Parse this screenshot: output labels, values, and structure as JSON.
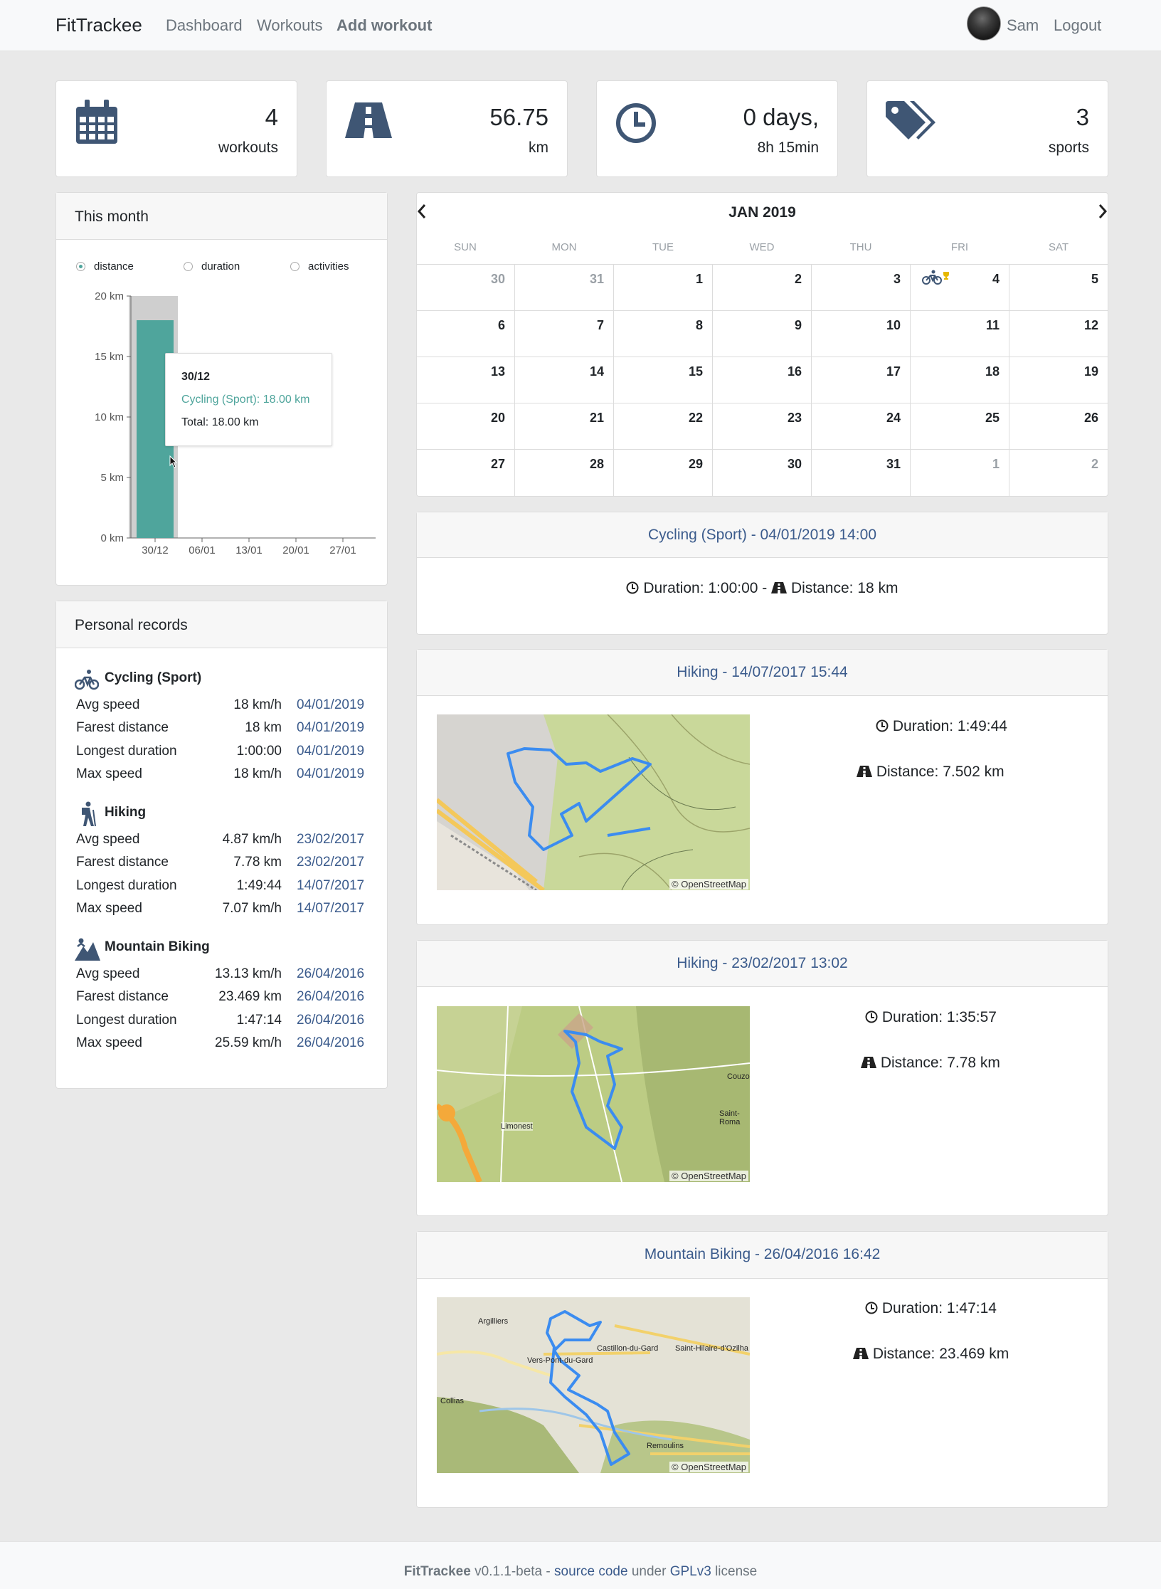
{
  "navbar": {
    "brand": "FitTrackee",
    "links": [
      "Dashboard",
      "Workouts",
      "Add workout"
    ],
    "user": "Sam",
    "logout": "Logout"
  },
  "stats": [
    {
      "icon": "calendar-icon",
      "value": "4",
      "label": "workouts"
    },
    {
      "icon": "road-icon",
      "value": "56.75",
      "label": "km"
    },
    {
      "icon": "clock-icon",
      "value": "0 days,",
      "label": "8h 15min"
    },
    {
      "icon": "tags-icon",
      "value": "3",
      "label": "sports"
    }
  ],
  "month": {
    "title": "This month",
    "options": [
      "distance",
      "duration",
      "activities"
    ],
    "selected": "distance",
    "tooltip": {
      "date": "30/12",
      "series": "Cycling (Sport): 18.00 km",
      "total": "Total: 18.00 km"
    }
  },
  "chart_data": {
    "type": "bar",
    "categories": [
      "30/12",
      "06/01",
      "13/01",
      "20/01",
      "27/01"
    ],
    "series": [
      {
        "name": "Cycling (Sport)",
        "values": [
          18,
          0,
          0,
          0,
          0
        ]
      }
    ],
    "yticks": [
      "0 km",
      "5 km",
      "10 km",
      "15 km",
      "20 km"
    ],
    "ylim": [
      0,
      20
    ],
    "colors": {
      "bar": "#4fa59c",
      "hover": "#cfcfcf"
    }
  },
  "records": {
    "title": "Personal records",
    "groups": [
      {
        "sport": "Cycling (Sport)",
        "icon": "cycling-icon",
        "rows": [
          {
            "label": "Avg speed",
            "value": "18 km/h",
            "date": "04/01/2019"
          },
          {
            "label": "Farest distance",
            "value": "18 km",
            "date": "04/01/2019"
          },
          {
            "label": "Longest duration",
            "value": "1:00:00",
            "date": "04/01/2019"
          },
          {
            "label": "Max speed",
            "value": "18 km/h",
            "date": "04/01/2019"
          }
        ]
      },
      {
        "sport": "Hiking",
        "icon": "hiking-icon",
        "rows": [
          {
            "label": "Avg speed",
            "value": "4.87 km/h",
            "date": "23/02/2017"
          },
          {
            "label": "Farest distance",
            "value": "7.78 km",
            "date": "23/02/2017"
          },
          {
            "label": "Longest duration",
            "value": "1:49:44",
            "date": "14/07/2017"
          },
          {
            "label": "Max speed",
            "value": "7.07 km/h",
            "date": "14/07/2017"
          }
        ]
      },
      {
        "sport": "Mountain Biking",
        "icon": "mountain-biking-icon",
        "rows": [
          {
            "label": "Avg speed",
            "value": "13.13 km/h",
            "date": "26/04/2016"
          },
          {
            "label": "Farest distance",
            "value": "23.469 km",
            "date": "26/04/2016"
          },
          {
            "label": "Longest duration",
            "value": "1:47:14",
            "date": "26/04/2016"
          },
          {
            "label": "Max speed",
            "value": "25.59 km/h",
            "date": "26/04/2016"
          }
        ]
      }
    ]
  },
  "calendar": {
    "title": "JAN 2019",
    "days_of_week": [
      "SUN",
      "MON",
      "TUE",
      "WED",
      "THU",
      "FRI",
      "SAT"
    ],
    "weeks": [
      [
        "30",
        "31",
        "1",
        "2",
        "3",
        "4",
        "5"
      ],
      [
        "6",
        "7",
        "8",
        "9",
        "10",
        "11",
        "12"
      ],
      [
        "13",
        "14",
        "15",
        "16",
        "17",
        "18",
        "19"
      ],
      [
        "20",
        "21",
        "22",
        "23",
        "24",
        "25",
        "26"
      ],
      [
        "27",
        "28",
        "29",
        "30",
        "31",
        "1",
        "2"
      ]
    ]
  },
  "workouts": [
    {
      "title": "Cycling (Sport) - 04/01/2019 14:00",
      "summary": "Duration: 1:00:00 - ",
      "distance": "Distance: 18 km"
    },
    {
      "title": "Hiking - 14/07/2017 15:44",
      "duration": "Duration: 1:49:44",
      "distance": "Distance: 7.502 km",
      "map_credit": "© OpenStreetMap"
    },
    {
      "title": "Hiking - 23/02/2017 13:02",
      "duration": "Duration: 1:35:57",
      "distance": "Distance: 7.78 km",
      "map_credit": "© OpenStreetMap",
      "places": [
        "Limonest",
        "Saint-Roma",
        "Couzo"
      ]
    },
    {
      "title": "Mountain Biking - 26/04/2016 16:42",
      "duration": "Duration: 1:47:14",
      "distance": "Distance: 23.469 km",
      "map_credit": "© OpenStreetMap",
      "places": [
        "Argilliers",
        "Castillon-du-Gard",
        "Saint-Hilaire-d'Ozilha",
        "Vers-Pont-du-Gard",
        "Collias",
        "Remoulins"
      ]
    }
  ],
  "footer": {
    "name": "FitTrackee",
    "version": "v0.1.1-beta - ",
    "source": "source code",
    "under": " under ",
    "license": "GPLv3",
    "suffix": " license"
  }
}
